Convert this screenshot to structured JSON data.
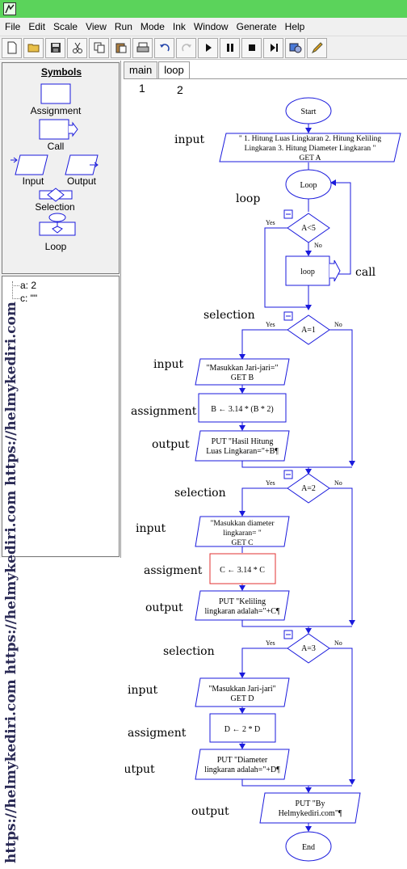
{
  "menu": [
    "File",
    "Edit",
    "Scale",
    "View",
    "Run",
    "Mode",
    "Ink",
    "Window",
    "Generate",
    "Help"
  ],
  "toolbar_icons": [
    "new-file-icon",
    "open-folder-icon",
    "save-icon",
    "cut-icon",
    "copy-icon",
    "paste-icon",
    "print-icon",
    "undo-icon",
    "redo-icon",
    "play-icon",
    "pause-icon",
    "stop-icon",
    "step-icon",
    "debug-icon",
    "pen-icon"
  ],
  "symbols": {
    "title": "Symbols",
    "assignment": "Assignment",
    "call": "Call",
    "input": "Input",
    "output": "Output",
    "selection": "Selection",
    "loop": "Loop"
  },
  "variables": [
    "a: 2",
    "c: \"\""
  ],
  "tabs": [
    "main",
    "loop"
  ],
  "tab_numbers": [
    "1",
    "2"
  ],
  "watermark": "https://helmykediri.com https://helmykediri.com https://helmykediri.com",
  "flowchart": {
    "start": "Start",
    "end": "End",
    "input1": [
      "\" 1. Hitung Luas Lingkaran 2. Hitung Keliling",
      "Lingkaran 3. Hitung Diameter Lingkaran \"",
      "GET A"
    ],
    "loop": "Loop",
    "loop_cond": "A<5",
    "loop_call": "loop",
    "yes": "Yes",
    "no": "No",
    "sel1_cond": "A=1",
    "sel1_input": [
      "\"Masukkan Jari-jari=\"",
      "GET B"
    ],
    "sel1_assign": "B ← 3.14 * (B * 2)",
    "sel1_output": [
      "PUT \"Hasil Hitung",
      "Luas Lingkaran=\"+B¶"
    ],
    "sel2_cond": "A=2",
    "sel2_input": [
      "\"Masukkan diameter",
      "lingkaran= \"",
      "GET C"
    ],
    "sel2_assign": "C ← 3.14 * C",
    "sel2_output": [
      "PUT \"Keliling",
      "lingkaran adalah=\"+C¶"
    ],
    "sel3_cond": "A=3",
    "sel3_input": [
      "\"Masukkan Jari-jari\"",
      "GET D"
    ],
    "sel3_assign": "D ← 2 * D",
    "sel3_output": [
      "PUT \"Diameter",
      "lingkaran adalah=\"+D¶"
    ],
    "final_output": [
      "PUT \"By",
      "Helmykediri.com\"¶"
    ]
  },
  "annotations": {
    "input1": "input",
    "loop": "loop",
    "call": "call",
    "selection1": "selection",
    "input2": "input",
    "assignment1": "assignment",
    "output1": "output",
    "selection2": "selection",
    "input3": "input",
    "assigment2": "assigment",
    "output2": "output",
    "selection3": "selection",
    "input4": "input",
    "assigment3": "assigment",
    "output3": "output",
    "output4": "output"
  },
  "colors": {
    "flow_blue": "#1a1adc",
    "highlight_red": "#e03030",
    "titlebar_green": "#5bd35b"
  }
}
